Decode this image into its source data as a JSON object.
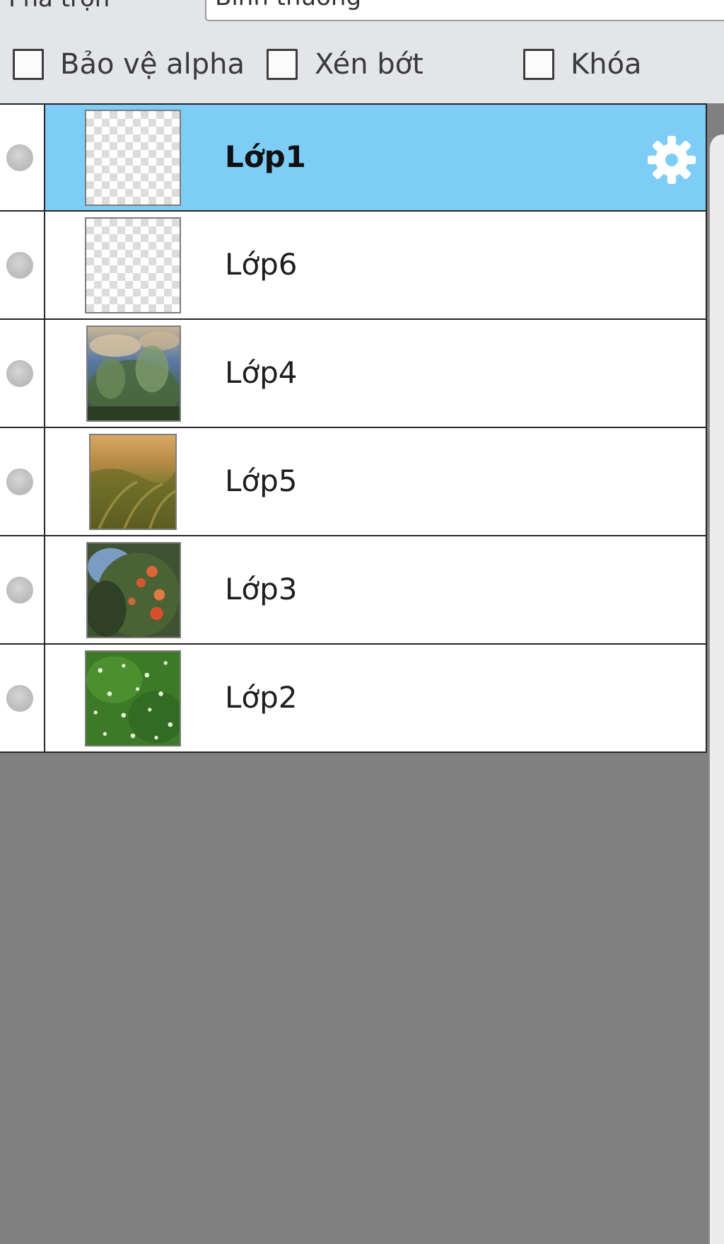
{
  "blend": {
    "label": "Pha trộn",
    "value": "Bình thường"
  },
  "options": {
    "protect_alpha": {
      "label": "Bảo vệ alpha",
      "checked": false
    },
    "clip": {
      "label": "Xén bớt",
      "checked": false
    },
    "lock": {
      "label": "Khóa",
      "checked": false
    }
  },
  "layers": [
    {
      "name": "Lớp1",
      "selected": true,
      "thumbnail": "transparent",
      "icon": "gear-icon"
    },
    {
      "name": "Lớp6",
      "selected": false,
      "thumbnail": "transparent"
    },
    {
      "name": "Lớp4",
      "selected": false,
      "thumbnail": "sky-trees-photo"
    },
    {
      "name": "Lớp5",
      "selected": false,
      "thumbnail": "grass-sunset-photo"
    },
    {
      "name": "Lớp3",
      "selected": false,
      "thumbnail": "fruit-tree-photo"
    },
    {
      "name": "Lớp2",
      "selected": false,
      "thumbnail": "green-meadow-photo"
    }
  ],
  "colors": {
    "selected_row": "#7ecdf7",
    "panel_background": "#808080"
  }
}
